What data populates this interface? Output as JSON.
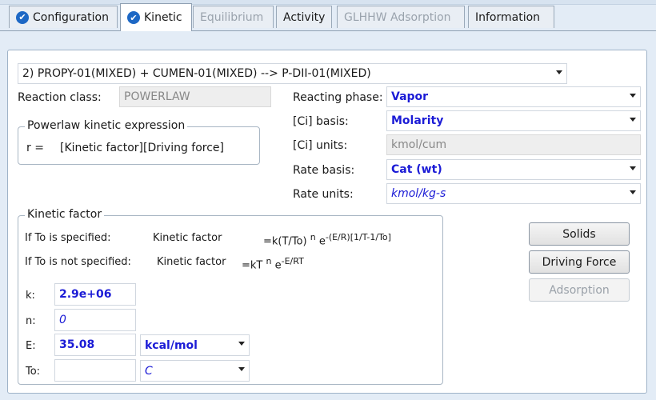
{
  "tabs": [
    {
      "label": "Configuration",
      "checked": true,
      "state": "normal"
    },
    {
      "label": "Kinetic",
      "checked": true,
      "state": "active"
    },
    {
      "label": "Equilibrium",
      "checked": false,
      "state": "disabled"
    },
    {
      "label": "Activity",
      "checked": false,
      "state": "normal"
    },
    {
      "label": "GLHHW Adsorption",
      "checked": false,
      "state": "disabled"
    },
    {
      "label": "Information",
      "checked": false,
      "state": "normal"
    }
  ],
  "reaction_select": "2) PROPY-01(MIXED)  + CUMEN-01(MIXED)  -->  P-DII-01(MIXED)",
  "reaction_class": {
    "label": "Reaction class:",
    "value": "POWERLAW"
  },
  "powerlaw": {
    "caption": "Powerlaw kinetic expression",
    "r_label": "r =",
    "expression": "[Kinetic factor][Driving force]"
  },
  "right_fields": {
    "reacting_phase": {
      "label": "Reacting phase:",
      "value": "Vapor"
    },
    "ci_basis": {
      "label": "[Ci] basis:",
      "value": "Molarity"
    },
    "ci_units": {
      "label": "[Ci] units:",
      "value": "kmol/cum"
    },
    "rate_basis": {
      "label": "Rate basis:",
      "value": "Cat (wt)"
    },
    "rate_units": {
      "label": "Rate units:",
      "value": "kmol/kg-s"
    }
  },
  "kinetic_factor": {
    "caption": "Kinetic factor",
    "line1": {
      "condition": "If To is specified:",
      "name": "Kinetic factor",
      "eq": "=k(T/To)",
      "sup_n": "n",
      "e": "e",
      "exp": "-(E/R)[1/T-1/To]"
    },
    "line2": {
      "condition": "If To is not specified:",
      "name": "Kinetic factor",
      "eq": "=kT",
      "sup_n": "n",
      "e": "e",
      "exp": "-E/RT"
    },
    "k": {
      "label": "k:",
      "value": "2.9e+06"
    },
    "n": {
      "label": "n:",
      "value": "0"
    },
    "E": {
      "label": "E:",
      "value": "35.08",
      "unit": "kcal/mol"
    },
    "To": {
      "label": "To:",
      "value": "",
      "unit": "C"
    }
  },
  "buttons": {
    "solids": "Solids",
    "driving_force": "Driving Force",
    "adsorption": "Adsorption"
  },
  "colors": {
    "accent_blue": "#1b1bd6",
    "tab_check": "#1d68c5"
  }
}
